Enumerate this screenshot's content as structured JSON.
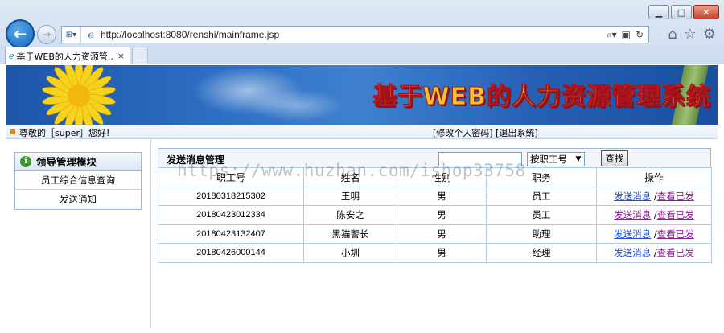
{
  "browser": {
    "url": "http://localhost:8080/renshi/mainframe.jsp",
    "tab_title": "基于WEB的人力资源管...",
    "tab_close": "×"
  },
  "banner": {
    "title": "基于WEB的人力资源管理系统"
  },
  "status_bar": {
    "greeting": "尊敬的［super］您好!",
    "edit_password": "[修改个人密码]",
    "logout": "[退出系统]"
  },
  "sidebar": {
    "module_title": "领导管理模块",
    "items": [
      {
        "label": "员工综合信息查询"
      },
      {
        "label": "发送通知"
      }
    ]
  },
  "main": {
    "title": "发送消息管理",
    "search": {
      "value": "",
      "select_value": "按职工号",
      "button_label": "查找"
    },
    "columns": [
      "职工号",
      "姓名",
      "性别",
      "职务",
      "操作"
    ],
    "rows": [
      {
        "id": "20180318215302",
        "name": "王明",
        "gender": "男",
        "position": "员工",
        "send": "发送消息",
        "sep": "/",
        "view": "查看已发"
      },
      {
        "id": "20180423012334",
        "name": "陈安之",
        "gender": "男",
        "position": "员工",
        "send": "发送消息",
        "sep": "/",
        "view": "查看已发"
      },
      {
        "id": "20180423132407",
        "name": "黑猫警长",
        "gender": "男",
        "position": "助理",
        "send": "发送消息",
        "sep": "/",
        "view": "查看已发"
      },
      {
        "id": "20180426000144",
        "name": "小圳",
        "gender": "男",
        "position": "经理",
        "send": "发送消息",
        "sep": "/",
        "view": "查看已发"
      }
    ]
  },
  "watermark": "https://www.huzhan.com/ishop33758",
  "colors": {
    "banner_title": "#f7c22a",
    "link": "#1a4fd6",
    "visited_link": "#8a1c92",
    "banner_bg": "#2d6fc4"
  }
}
